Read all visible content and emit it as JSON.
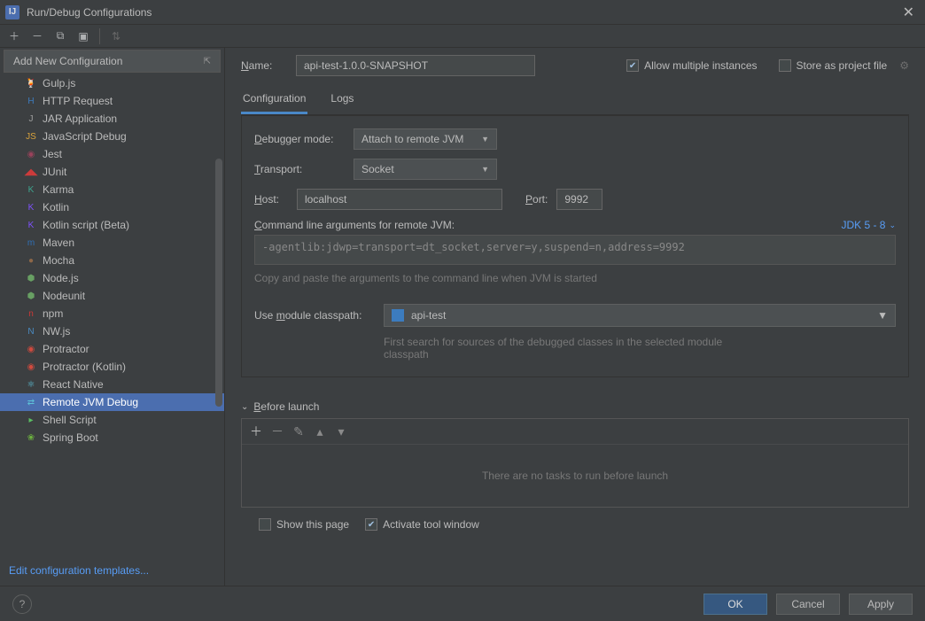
{
  "title": "Run/Debug Configurations",
  "sidebar": {
    "header": "Add New Configuration",
    "items": [
      {
        "label": "Gulp.js",
        "icon": "🍹",
        "color": "#cc4a3c"
      },
      {
        "label": "HTTP Request",
        "icon": "H",
        "color": "#3c7cbf"
      },
      {
        "label": "JAR Application",
        "icon": "J",
        "color": "#a0a0a0"
      },
      {
        "label": "JavaScript Debug",
        "icon": "JS",
        "color": "#d9a33c"
      },
      {
        "label": "Jest",
        "icon": "◉",
        "color": "#99425b"
      },
      {
        "label": "JUnit",
        "icon": "◢◣",
        "color": "#cc3b3b"
      },
      {
        "label": "Karma",
        "icon": "K",
        "color": "#3ea58f"
      },
      {
        "label": "Kotlin",
        "icon": "K",
        "color": "#7f52ff"
      },
      {
        "label": "Kotlin script (Beta)",
        "icon": "K",
        "color": "#7f52ff"
      },
      {
        "label": "Maven",
        "icon": "m",
        "color": "#2f6fb5"
      },
      {
        "label": "Mocha",
        "icon": "●",
        "color": "#8d6748"
      },
      {
        "label": "Node.js",
        "icon": "⬢",
        "color": "#68a063"
      },
      {
        "label": "Nodeunit",
        "icon": "⬢",
        "color": "#68a063"
      },
      {
        "label": "npm",
        "icon": "n",
        "color": "#cb3837"
      },
      {
        "label": "NW.js",
        "icon": "N",
        "color": "#4a8bc2"
      },
      {
        "label": "Protractor",
        "icon": "◉",
        "color": "#d04a3e"
      },
      {
        "label": "Protractor (Kotlin)",
        "icon": "◉",
        "color": "#d04a3e"
      },
      {
        "label": "React Native",
        "icon": "⚛",
        "color": "#5dc1d8"
      },
      {
        "label": "Remote JVM Debug",
        "icon": "⇄",
        "color": "#5dc1d8",
        "selected": true
      },
      {
        "label": "Shell Script",
        "icon": "▸",
        "color": "#5bbf63"
      },
      {
        "label": "Spring Boot",
        "icon": "❀",
        "color": "#6db33f"
      }
    ],
    "edit_templates": "Edit configuration templates..."
  },
  "form": {
    "name_label": "Name:",
    "name_value": "api-test-1.0.0-SNAPSHOT",
    "allow_multiple": "Allow multiple instances",
    "store_project": "Store as project file",
    "tabs": {
      "config": "Configuration",
      "logs": "Logs"
    },
    "debugger_mode_label": "Debugger mode:",
    "debugger_mode_value": "Attach to remote JVM",
    "transport_label": "Transport:",
    "transport_value": "Socket",
    "host_label": "Host:",
    "host_value": "localhost",
    "port_label": "Port:",
    "port_value": "9992",
    "cmd_label": "Command line arguments for remote JVM:",
    "jdk": "JDK 5 - 8",
    "cmd_value": "-agentlib:jdwp=transport=dt_socket,server=y,suspend=n,address=9992",
    "cmd_hint": "Copy and paste the arguments to the command line when JVM is started",
    "module_label": "Use module classpath:",
    "module_value": "api-test",
    "module_hint": "First search for sources of the debugged classes in the selected module classpath",
    "before_launch": "Before launch",
    "bl_empty": "There are no tasks to run before launch",
    "show_page": "Show this page",
    "activate_tool": "Activate tool window"
  },
  "buttons": {
    "ok": "OK",
    "cancel": "Cancel",
    "apply": "Apply"
  }
}
